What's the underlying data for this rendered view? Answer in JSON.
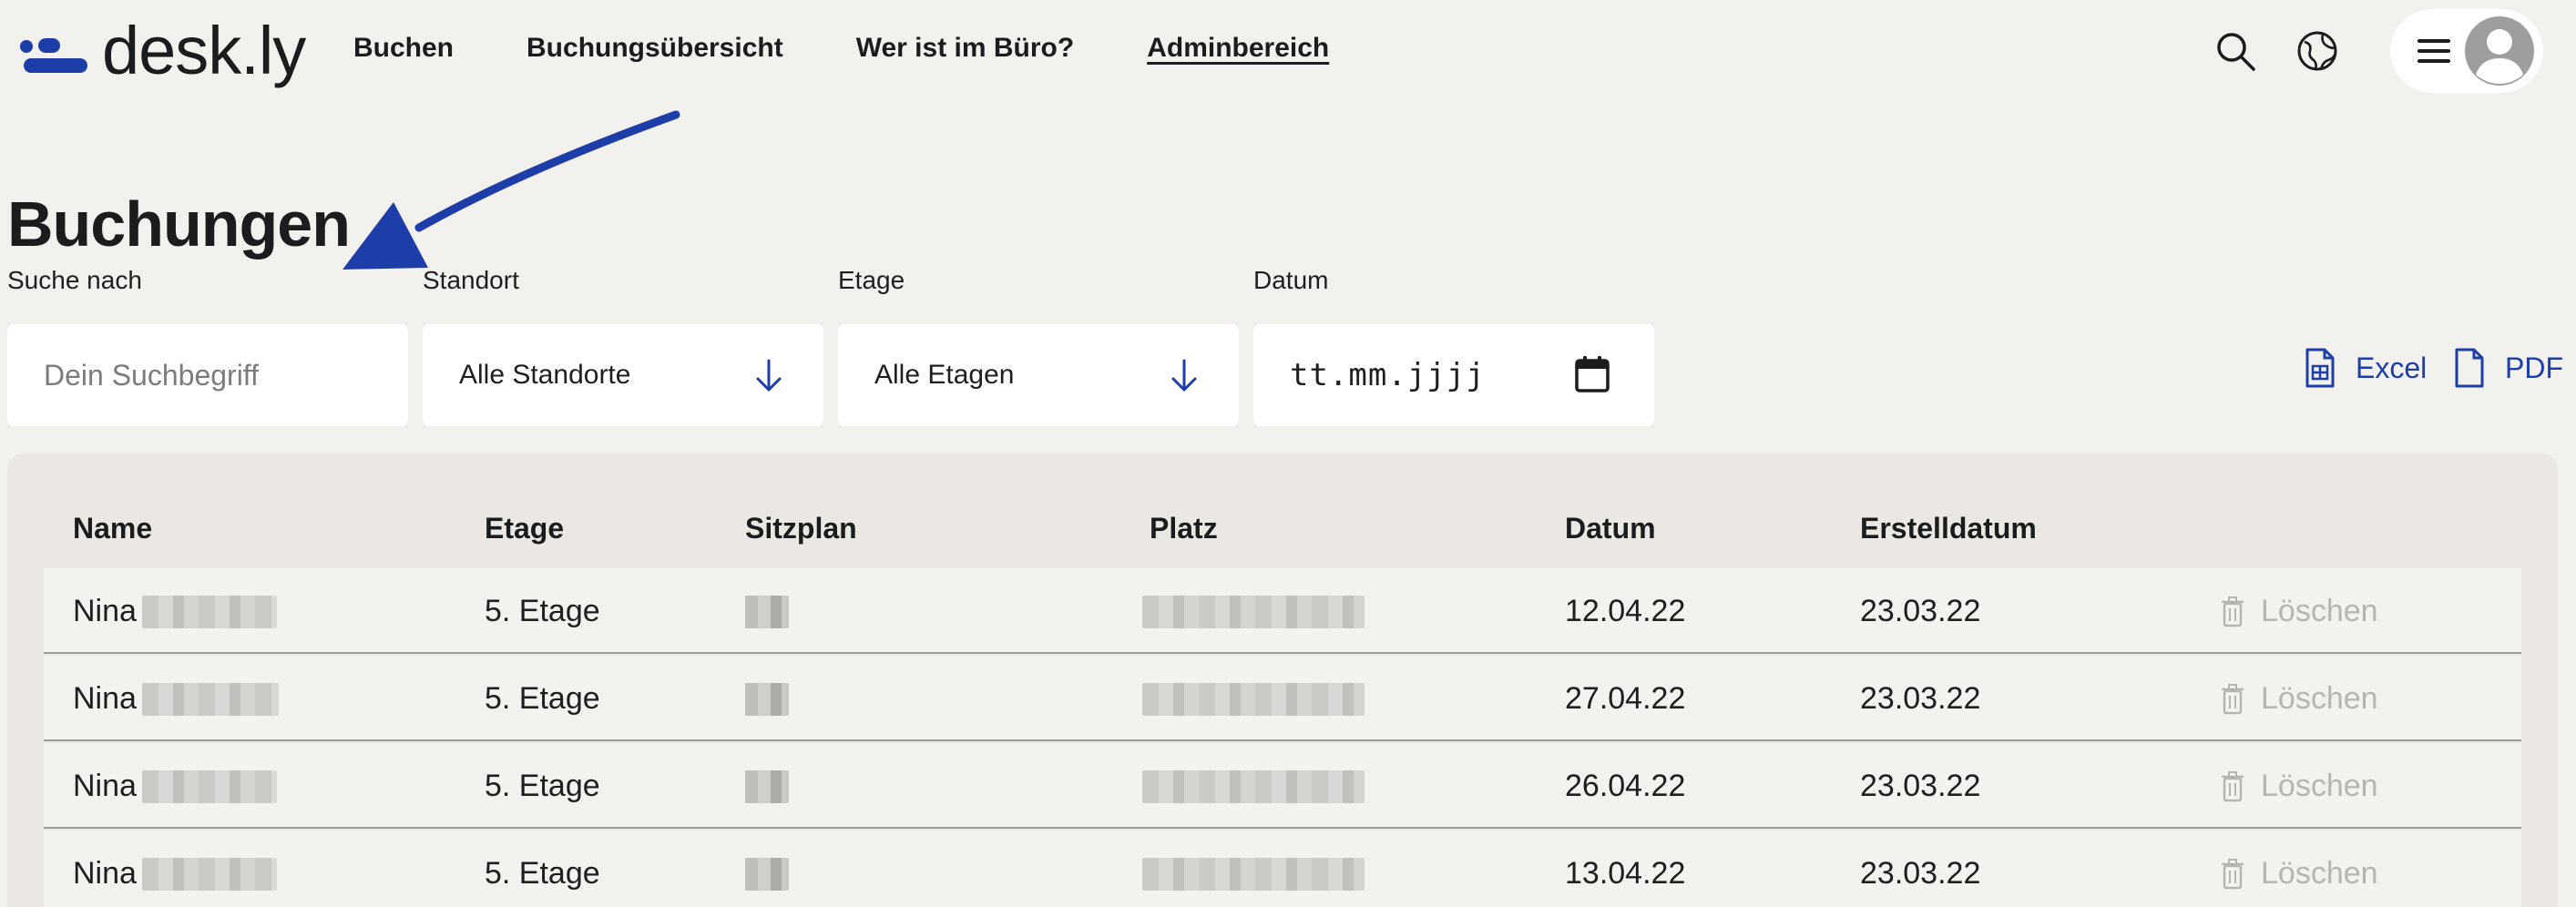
{
  "app": {
    "logo_text": "desk.ly",
    "brand_color": "#1d3ea8"
  },
  "nav": {
    "items": [
      {
        "label": "Buchen"
      },
      {
        "label": "Buchungsübersicht"
      },
      {
        "label": "Wer ist im Büro?"
      },
      {
        "label": "Adminbereich",
        "active": true
      }
    ]
  },
  "header_icons": {
    "search": "search-icon",
    "language": "globe-icon",
    "menu": "hamburger-icon",
    "profile": "avatar-icon"
  },
  "page": {
    "title": "Buchungen"
  },
  "filters": {
    "search": {
      "label": "Suche nach",
      "placeholder": "Dein Suchbegriff"
    },
    "location": {
      "label": "Standort",
      "value": "Alle Standorte"
    },
    "floor": {
      "label": "Etage",
      "value": "Alle Etagen"
    },
    "date": {
      "label": "Datum",
      "value": "tt.mm.jjjj"
    }
  },
  "export": {
    "excel_label": "Excel",
    "pdf_label": "PDF"
  },
  "table": {
    "columns": [
      "Name",
      "Etage",
      "Sitzplan",
      "Platz",
      "Datum",
      "Erstelldatum"
    ],
    "delete_label": "Löschen",
    "rows": [
      {
        "name": "Nina",
        "floor": "5. Etage",
        "date": "12.04.22",
        "created": "23.03.22"
      },
      {
        "name": "Nina",
        "floor": "5. Etage",
        "date": "27.04.22",
        "created": "23.03.22"
      },
      {
        "name": "Nina",
        "floor": "5. Etage",
        "date": "26.04.22",
        "created": "23.03.22"
      },
      {
        "name": "Nina",
        "floor": "5. Etage",
        "date": "13.04.22",
        "created": "23.03.22"
      }
    ]
  }
}
